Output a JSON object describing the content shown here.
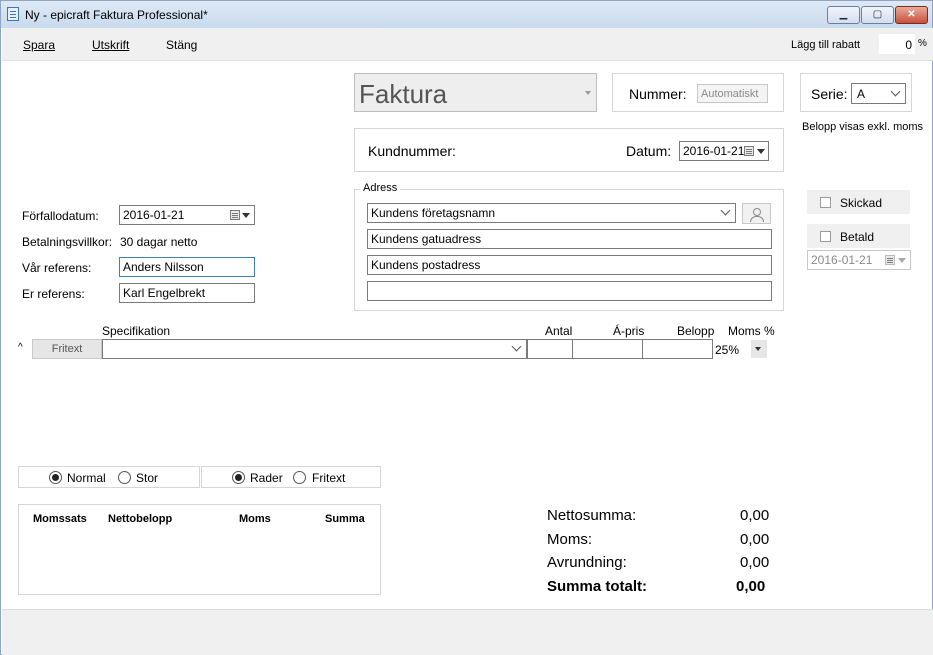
{
  "window": {
    "title": "Ny - epicraft Faktura Professional*"
  },
  "menu": {
    "save": "Spara",
    "print": "Utskrift",
    "close": "Stäng"
  },
  "discount": {
    "label": "Lägg till rabatt",
    "value": "0",
    "unit": "%"
  },
  "doc_type": {
    "value": "Faktura"
  },
  "number": {
    "label": "Nummer:",
    "placeholder": "Automatiskt"
  },
  "series": {
    "label": "Serie:",
    "value": "A",
    "note": "Belopp visas exkl. moms"
  },
  "customer": {
    "number_label": "Kundnummer:",
    "date_label": "Datum:",
    "date_value": "2016-01-21"
  },
  "address": {
    "legend": "Adress",
    "company_placeholder": "Kundens företagsnamn",
    "street_placeholder": "Kundens gatuadress",
    "postal_placeholder": "Kundens postadress",
    "extra": ""
  },
  "status": {
    "sent_label": "Skickad",
    "paid_label": "Betald",
    "paid_date": "2016-01-21"
  },
  "terms": {
    "due_label": "Förfallodatum:",
    "due_value": "2016-01-21",
    "payment_label": "Betalningsvillkor:",
    "payment_value": "30 dagar netto",
    "our_ref_label": "Vår referens:",
    "our_ref_value": "Anders Nilsson",
    "their_ref_label": "Er referens:",
    "their_ref_value": "Karl Engelbrekt"
  },
  "rows": {
    "headers": {
      "spec": "Specifikation",
      "qty": "Antal",
      "price": "Á-pris",
      "amount": "Belopp",
      "vat": "Moms %"
    },
    "caret": "^",
    "first": {
      "type": "Fritext",
      "spec": "",
      "qty": "",
      "price": "",
      "amount": "",
      "vat": "25%"
    }
  },
  "view": {
    "size": {
      "normal": "Normal",
      "large": "Stor",
      "selected": "Normal"
    },
    "mode": {
      "rows": "Rader",
      "free": "Fritext",
      "selected": "Rader"
    }
  },
  "vat_table": {
    "headers": [
      "Momssats",
      "Nettobelopp",
      "Moms",
      "Summa"
    ]
  },
  "totals": {
    "net_label": "Nettosumma:",
    "net_value": "0,00",
    "vat_label": "Moms:",
    "vat_value": "0,00",
    "rounding_label": "Avrundning:",
    "rounding_value": "0,00",
    "total_label": "Summa totalt:",
    "total_value": "0,00"
  },
  "window_buttons": {
    "min": "▁",
    "max": "▢",
    "close": "✕"
  }
}
